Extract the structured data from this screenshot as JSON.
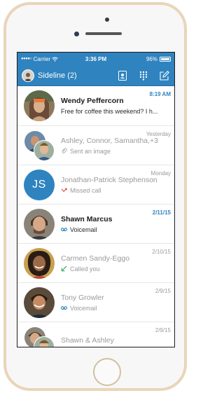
{
  "status_bar": {
    "carrier": "Carrier",
    "time": "3:36 PM",
    "battery": "96%",
    "battery_level": 0.96
  },
  "nav": {
    "title": "Sideline (2)",
    "actions": [
      "contacts-icon",
      "dialpad-icon",
      "compose-icon"
    ]
  },
  "colors": {
    "accent": "#2f83bf",
    "missed": "#e05050",
    "received": "#3aa859",
    "voicemail": "#2f83bf"
  },
  "conversations": [
    {
      "name": "Wendy Peffercorn",
      "preview": "Free for coffee this weekend? I h...",
      "time": "8:19 AM",
      "unread": true,
      "avatar": "photo",
      "icon": ""
    },
    {
      "name": "Ashley, Connor, Samantha,+3",
      "preview": "Sent an image",
      "time": "Yesterday",
      "unread": false,
      "avatar": "group-photo",
      "icon": "paperclip-icon"
    },
    {
      "name": "Jonathan-Patrick Stephenson",
      "preview": "Missed call",
      "time": "Monday",
      "unread": false,
      "avatar_initials": "JS",
      "icon": "missed-call-icon"
    },
    {
      "name": "Shawn Marcus",
      "preview": "Voicemail",
      "time": "2/11/15",
      "unread": true,
      "avatar": "photo",
      "icon": "voicemail-icon"
    },
    {
      "name": "Carmen Sandy-Eggo",
      "preview": "Called you",
      "time": "2/10/15",
      "unread": false,
      "avatar": "photo",
      "icon": "incoming-call-icon"
    },
    {
      "name": "Tony Growler",
      "preview": "Voicemail",
      "time": "2/9/15",
      "unread": false,
      "avatar": "photo",
      "icon": "voicemail-icon"
    },
    {
      "name": "Shawn & Ashley",
      "preview": "",
      "time": "2/9/15",
      "unread": false,
      "avatar": "group-photo",
      "icon": ""
    }
  ]
}
